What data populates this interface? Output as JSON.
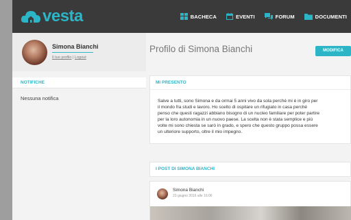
{
  "brand": {
    "name": "vesta",
    "accent": "#2bb5c7",
    "topbar_bg": "#3a3a3a"
  },
  "nav": {
    "items": [
      {
        "label": "BACHECA",
        "icon": "board-icon"
      },
      {
        "label": "EVENTI",
        "icon": "calendar-icon"
      },
      {
        "label": "FORUM",
        "icon": "chat-icon"
      },
      {
        "label": "DOCUMENTI",
        "icon": "folder-icon"
      }
    ]
  },
  "profile": {
    "name": "Simona Bianchi",
    "link_profile": "Il tuo profilo",
    "separator": "|",
    "link_logout": "Logout"
  },
  "notifications": {
    "header": "NOTIFICHE",
    "empty_text": "Nessuna notifica"
  },
  "main": {
    "title": "Profilo di Simona Bianchi",
    "edit_button": "MODIFICA"
  },
  "presentation": {
    "header": "MI PRESENTO",
    "lines": [
      "Salve a tutti, sono Simona e da ormai 5 anni vivo da sola perché mi è in giro per",
      "il mondo fra studi e lavoro. Ho scelto di ospitare un rifugiato in casa perché",
      "penso che questi ragazzi abbiano bisogno di un nucleo familiare per poter partire",
      "per la loro autonomia in un nuovo paese. La scelta non è stata semplice e più",
      "volte mi sono chiesta se sarò in grado, e spero che questo gruppo possa essere",
      "un ulteriore supporto, oltre il mio impegno."
    ]
  },
  "posts": {
    "header": "I POST DI SIMONA BIANCHI",
    "items": [
      {
        "author": "Simona Bianchi",
        "date": "23 giugno 2016 alle 16:06"
      }
    ]
  }
}
